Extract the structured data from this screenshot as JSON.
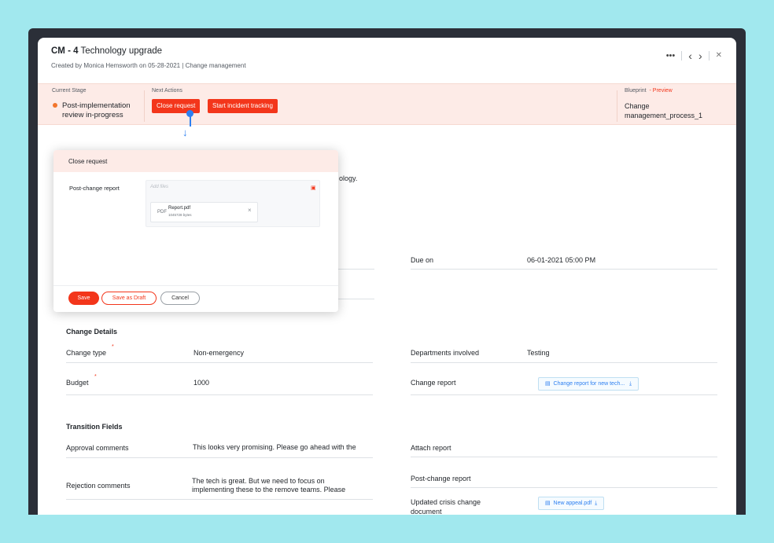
{
  "header": {
    "record_id": "CM - 4",
    "record_title": "Technology upgrade",
    "subtitle": "Created by Monica Hemsworth on 05-28-2021 | Change management",
    "more_icon": "•••",
    "prev_icon": "‹",
    "next_icon": "›",
    "close_icon": "✕"
  },
  "stagebar": {
    "current_stage_label": "Current Stage",
    "current_stage_value": "Post-implementation review in-progress",
    "next_actions_label": "Next Actions",
    "action_close": "Close request",
    "action_incident": "Start incident tracking",
    "blueprint_label": "Blueprint",
    "blueprint_preview": "- Preview",
    "blueprint_value": "Change management_process_1"
  },
  "background": {
    "partial_text": "ology.",
    "due_on_label": "Due on",
    "due_on_value": "06-01-2021 05:00 PM"
  },
  "change_details": {
    "heading": "Change Details",
    "change_type_label": "Change type",
    "change_type_value": "Non-emergency",
    "departments_label": "Departments involved",
    "departments_value": "Testing",
    "budget_label": "Budget",
    "budget_value": "1000",
    "change_report_label": "Change report",
    "change_report_file": "Change report for new tech..."
  },
  "transition_fields": {
    "heading": "Transition Fields",
    "approval_label": "Approval comments",
    "approval_value": "This looks very promising. Please go ahead with the",
    "attach_report_label": "Attach report",
    "rejection_label": "Rejection comments",
    "rejection_line1": "The tech is great. But we need to focus on",
    "rejection_line2": "implementing these to the remove teams. Please",
    "post_change_label": "Post-change report",
    "crisis_label_line1": "Updated crisis change",
    "crisis_label_line2": "document",
    "crisis_file": "New appeal.pdf"
  },
  "modal": {
    "title": "Close request",
    "field_label": "Post-change report",
    "dropzone_placeholder": "Add files",
    "file_type": "PDF",
    "file_name": "Report.pdf",
    "file_size": "1045728 bytes",
    "save_label": "Save",
    "draft_label": "Save as Draft",
    "cancel_label": "Cancel"
  },
  "colors": {
    "accent": "#f3361b",
    "link": "#2d7ff0",
    "stage_bg": "#fdebe7",
    "page_bg": "#a1e8ee"
  }
}
